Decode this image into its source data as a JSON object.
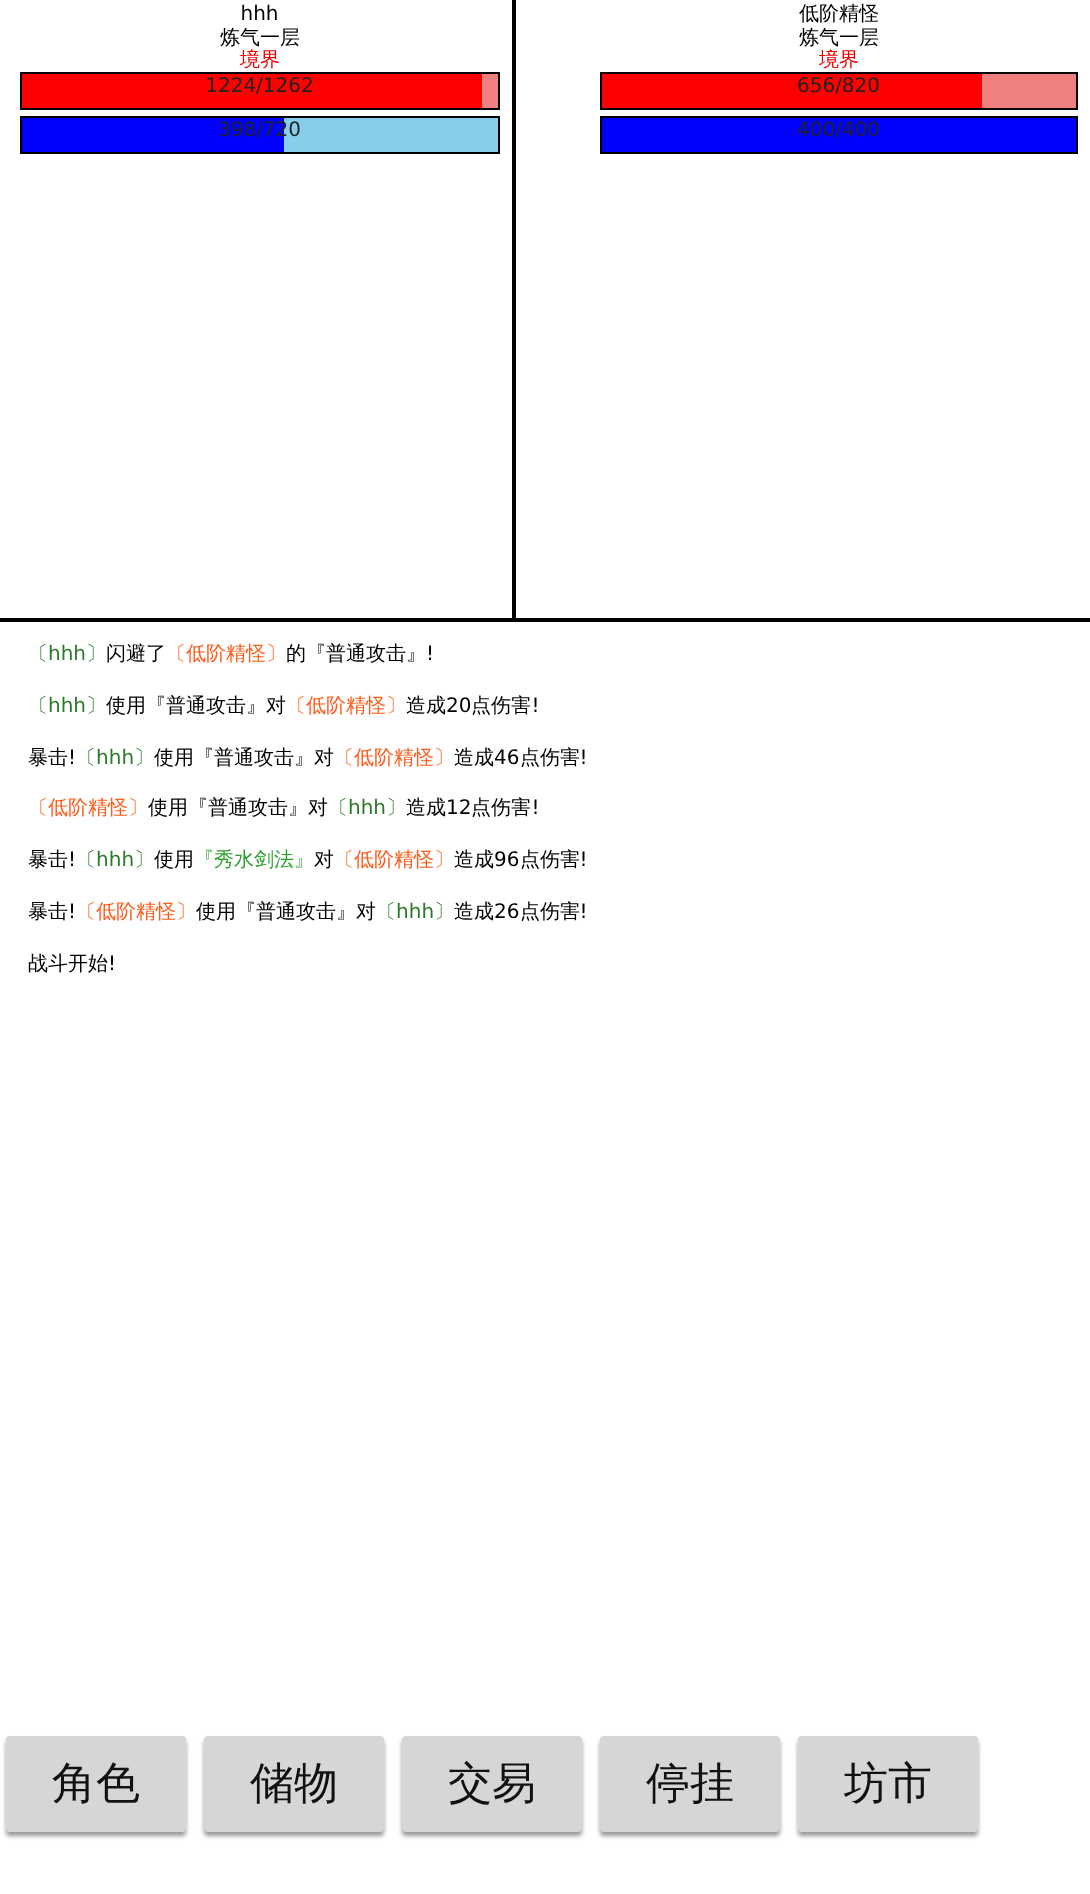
{
  "fighters": [
    {
      "name": "hhh",
      "realm": "炼气一层",
      "realm_label": "境界",
      "hp": {
        "reading": "1224/1262",
        "level": 0.97
      },
      "mp": {
        "reading": "398/720",
        "level": 0.55
      }
    },
    {
      "name": "低阶精怪",
      "realm": "炼气一层",
      "realm_label": "境界",
      "hp": {
        "reading": "656/820",
        "level": 0.8
      },
      "mp": {
        "reading": "400/400",
        "level": 1
      }
    }
  ],
  "battle_log": [
    [
      {
        "kind": "player",
        "text": "〔hhh〕"
      },
      {
        "kind": "plain",
        "text": "闪避了"
      },
      {
        "kind": "enemy",
        "text": "〔低阶精怪〕"
      },
      {
        "kind": "plain",
        "text": "的『普通攻击』!"
      }
    ],
    [
      {
        "kind": "player",
        "text": "〔hhh〕"
      },
      {
        "kind": "plain",
        "text": "使用『普通攻击』对"
      },
      {
        "kind": "enemy",
        "text": "〔低阶精怪〕"
      },
      {
        "kind": "plain",
        "text": "造成20点伤害!"
      }
    ],
    [
      {
        "kind": "plain",
        "text": "暴击!"
      },
      {
        "kind": "player",
        "text": "〔hhh〕"
      },
      {
        "kind": "plain",
        "text": "使用『普通攻击』对"
      },
      {
        "kind": "enemy",
        "text": "〔低阶精怪〕"
      },
      {
        "kind": "plain",
        "text": "造成46点伤害!"
      }
    ],
    [
      {
        "kind": "enemy",
        "text": "〔低阶精怪〕"
      },
      {
        "kind": "plain",
        "text": "使用『普通攻击』对"
      },
      {
        "kind": "player",
        "text": "〔hhh〕"
      },
      {
        "kind": "plain",
        "text": "造成12点伤害!"
      }
    ],
    [
      {
        "kind": "plain",
        "text": "暴击!"
      },
      {
        "kind": "player",
        "text": "〔hhh〕"
      },
      {
        "kind": "plain",
        "text": "使用"
      },
      {
        "kind": "skill",
        "text": "『秀水剑法』"
      },
      {
        "kind": "plain",
        "text": "对"
      },
      {
        "kind": "enemy",
        "text": "〔低阶精怪〕"
      },
      {
        "kind": "plain",
        "text": "造成96点伤害!"
      }
    ],
    [
      {
        "kind": "plain",
        "text": "暴击!"
      },
      {
        "kind": "enemy",
        "text": "〔低阶精怪〕"
      },
      {
        "kind": "plain",
        "text": "使用『普通攻击』对"
      },
      {
        "kind": "player",
        "text": "〔hhh〕"
      },
      {
        "kind": "plain",
        "text": "造成26点伤害!"
      }
    ],
    [
      {
        "kind": "plain",
        "text": "战斗开始!"
      }
    ]
  ],
  "buttons": [
    "角色",
    "储物",
    "交易",
    "停挂",
    "坊市"
  ]
}
